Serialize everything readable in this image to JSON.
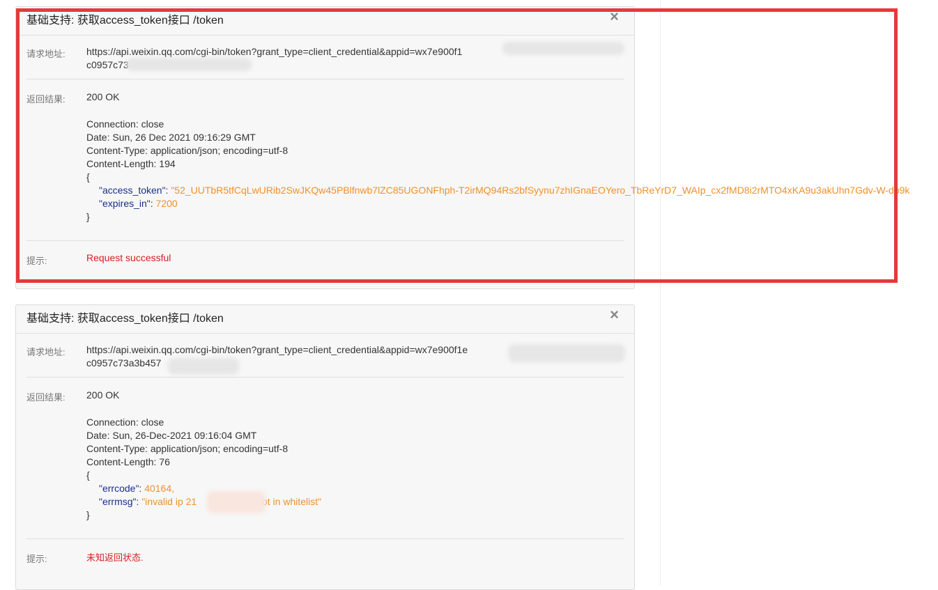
{
  "panels": [
    {
      "title": "基础支持: 获取access_token接口 /token",
      "close_icon": "×",
      "request_label": "请求地址:",
      "request_url_line1": "https://api.weixin.qq.com/cgi-bin/token?grant_type=client_credential&appid=wx7e900f1",
      "request_url_line2": "c0957c73",
      "result_label": "返回结果:",
      "status": "200 OK",
      "headers": [
        "Connection: close",
        "Date: Sun, 26 Dec 2021 09:16:29 GMT",
        "Content-Type: application/json; encoding=utf-8",
        "Content-Length: 194"
      ],
      "json_open": "{",
      "json_close": "}",
      "json_fields": [
        {
          "key": "\"access_token\"",
          "sep": ": ",
          "value": "\"52_UUTbR5tfCqLwURib2SwJKQw45PBlfnwb7lZC85UGONFhph-T2irMQ94Rs2bfSyynu7zhIGnaEOYero_TbReYrD7_WAIp_cx2fMD8i2rMTO4xKA9u3akUhn7Gdv-W-db9k",
          "end": ","
        },
        {
          "key": "\"expires_in\"",
          "sep": ": ",
          "value": "7200",
          "end": ""
        }
      ],
      "tip_label": "提示:",
      "tip_text": "Request successful"
    },
    {
      "title": "基础支持: 获取access_token接口 /token",
      "close_icon": "×",
      "request_label": "请求地址:",
      "request_url_line1": "https://api.weixin.qq.com/cgi-bin/token?grant_type=client_credential&appid=wx7e900f1e",
      "request_url_line2": "c0957c73a3b457",
      "result_label": "返回结果:",
      "status": "200 OK",
      "headers": [
        "Connection: close",
        "Date: Sun, 26-Dec-2021 09:16:04 GMT",
        "Content-Type: application/json; encoding=utf-8",
        "Content-Length: 76"
      ],
      "json_open": "{",
      "json_close": "}",
      "json_fields": [
        {
          "key": "\"errcode\"",
          "sep": ": ",
          "value": "40164",
          "end": ","
        },
        {
          "key": "\"errmsg\"",
          "sep": ": ",
          "value": "\"invalid ip 21",
          "value2": "not in whitelist\"",
          "end": ""
        }
      ],
      "tip_label": "提示:",
      "tip_text": "未知返回状态."
    }
  ],
  "colors": {
    "json_key": "#1a2d8c",
    "json_value": "#f0902a",
    "tip_text": "#d62020",
    "highlight_border": "#e33a3a"
  }
}
